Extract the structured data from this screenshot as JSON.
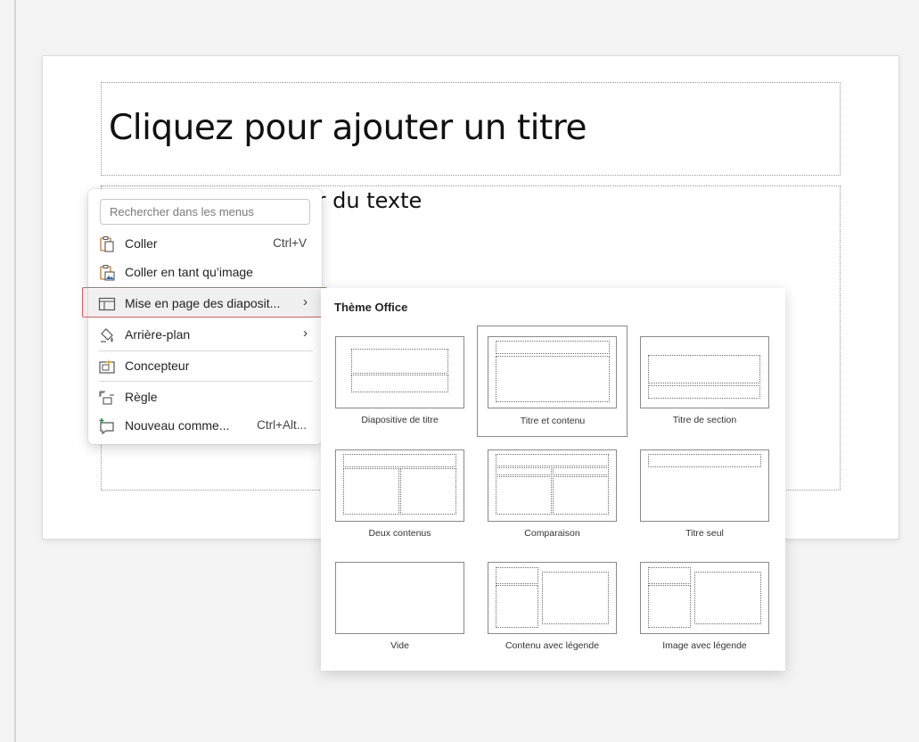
{
  "slide": {
    "title_placeholder": "Cliquez pour ajouter un titre",
    "body_placeholder": "Cliquez pour ajouter du texte"
  },
  "context_menu": {
    "search_placeholder": "Rechercher dans les menus",
    "items": [
      {
        "label": "Coller",
        "shortcut": "Ctrl+V",
        "icon": "paste-icon"
      },
      {
        "label": "Coller en tant qu’image",
        "shortcut": "",
        "icon": "paste-as-picture-icon"
      },
      {
        "label": "Mise en page des diaposit...",
        "shortcut": "",
        "icon": "slide-layout-icon",
        "submenu": true,
        "highlighted": true
      },
      {
        "label": "Arrière-plan",
        "shortcut": "",
        "icon": "background-icon",
        "submenu": true
      },
      {
        "label": "Concepteur",
        "shortcut": "",
        "icon": "designer-icon"
      },
      {
        "label": "Règle",
        "shortcut": "",
        "icon": "ruler-icon"
      },
      {
        "label": "Nouveau comme...",
        "shortcut": "Ctrl+Alt...",
        "icon": "new-comment-icon"
      }
    ],
    "highlight_color": "#e05a5a"
  },
  "layout_gallery": {
    "header": "Thème Office",
    "layouts": [
      {
        "label": "Diapositive de titre",
        "selected": false
      },
      {
        "label": "Titre et contenu",
        "selected": true
      },
      {
        "label": "Titre de section",
        "selected": false
      },
      {
        "label": "Deux contenus",
        "selected": false
      },
      {
        "label": "Comparaison",
        "selected": false
      },
      {
        "label": "Titre seul",
        "selected": false
      },
      {
        "label": "Vide",
        "selected": false
      },
      {
        "label": "Contenu avec légende",
        "selected": false
      },
      {
        "label": "Image avec légende",
        "selected": false
      }
    ]
  }
}
